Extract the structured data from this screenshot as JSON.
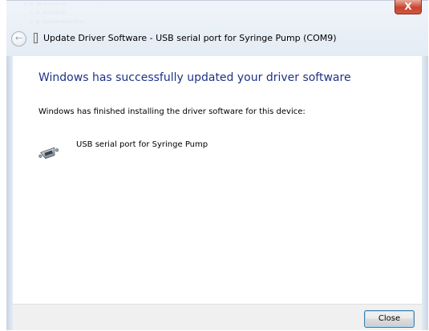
{
  "window": {
    "title": "Update Driver Software - USB serial port for Syringe Pump (COM9)",
    "close_glyph": "X"
  },
  "content": {
    "headline": "Windows has successfully updated your driver software",
    "finished_text": "Windows has finished installing the driver software for this device:",
    "device_name": "USB serial port for Syringe Pump",
    "device_icon": "serial-port-icon"
  },
  "footer": {
    "close_button_label": "Close"
  },
  "colors": {
    "headline": "#1e3287",
    "close_x_button": "#c7452f",
    "footer_background": "#f0f0f0"
  }
}
